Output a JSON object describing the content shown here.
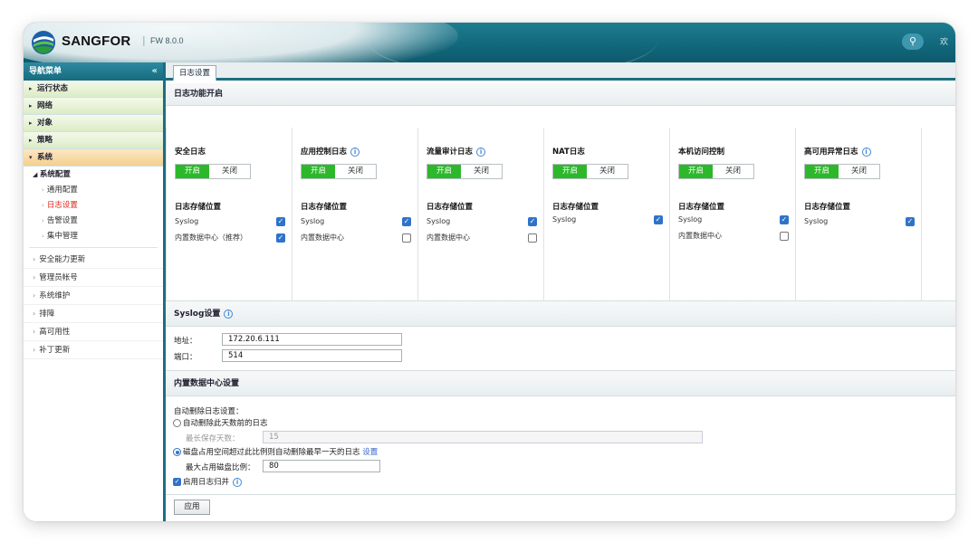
{
  "app": {
    "brand": "SANGFOR",
    "version": "FW 8.0.0",
    "cut_text": "欢"
  },
  "sidebar": {
    "title": "导航菜单",
    "collapse_glyph": "«",
    "groups": [
      {
        "label": "运行状态"
      },
      {
        "label": "网络"
      },
      {
        "label": "对象"
      },
      {
        "label": "策略"
      },
      {
        "label": "系统"
      }
    ],
    "sub_group": "系统配置",
    "leaves": [
      {
        "label": "通用配置"
      },
      {
        "label": "日志设置"
      },
      {
        "label": "告警设置"
      },
      {
        "label": "集中管理"
      }
    ],
    "items": [
      {
        "label": "安全能力更新"
      },
      {
        "label": "管理员帐号"
      },
      {
        "label": "系统维护"
      },
      {
        "label": "排障"
      },
      {
        "label": "高可用性"
      },
      {
        "label": "补丁更新"
      }
    ]
  },
  "tab": {
    "label": "日志设置"
  },
  "log_section": {
    "title": "日志功能开启",
    "on_label": "开启",
    "off_label": "关闭",
    "store_title": "日志存储位置",
    "columns": [
      {
        "title": "安全日志",
        "info": false,
        "rows": [
          {
            "label": "Syslog",
            "checked": true
          },
          {
            "label": "内置数据中心（推荐）",
            "checked": true
          }
        ]
      },
      {
        "title": "应用控制日志",
        "info": true,
        "rows": [
          {
            "label": "Syslog",
            "checked": true
          },
          {
            "label": "内置数据中心",
            "checked": false
          }
        ]
      },
      {
        "title": "流量审计日志",
        "info": true,
        "rows": [
          {
            "label": "Syslog",
            "checked": true
          },
          {
            "label": "内置数据中心",
            "checked": false
          }
        ]
      },
      {
        "title": "NAT日志",
        "info": false,
        "rows": [
          {
            "label": "Syslog",
            "checked": true
          }
        ]
      },
      {
        "title": "本机访问控制",
        "info": false,
        "rows": [
          {
            "label": "Syslog",
            "checked": true
          },
          {
            "label": "内置数据中心",
            "checked": false
          }
        ]
      },
      {
        "title": "高可用异常日志",
        "info": true,
        "rows": [
          {
            "label": "Syslog",
            "checked": true
          }
        ]
      }
    ]
  },
  "syslog": {
    "title": "Syslog设置",
    "address_label": "地址：",
    "address_value": "172.20.6.111",
    "port_label": "端口：",
    "port_value": "514"
  },
  "db": {
    "title": "内置数据中心设置",
    "auto_delete_label": "自动删除日志设置：",
    "option1": "自动删除此天数前的日志",
    "max_days_label": "最长保存天数：",
    "max_days_value": "15",
    "option2": "磁盘占用空间超过此比例则自动删除最早一天的日志",
    "option2_link": "设置",
    "ratio_label": "最大占用磁盘比例：",
    "ratio_value": "80",
    "merge_label": "启用日志归并",
    "apply_label": "应用"
  },
  "colors": {
    "header_teal": "#12687c",
    "toggle_on": "#2cb82a",
    "checkbox_blue": "#2f73c9",
    "active_nav": "#e0261b"
  }
}
